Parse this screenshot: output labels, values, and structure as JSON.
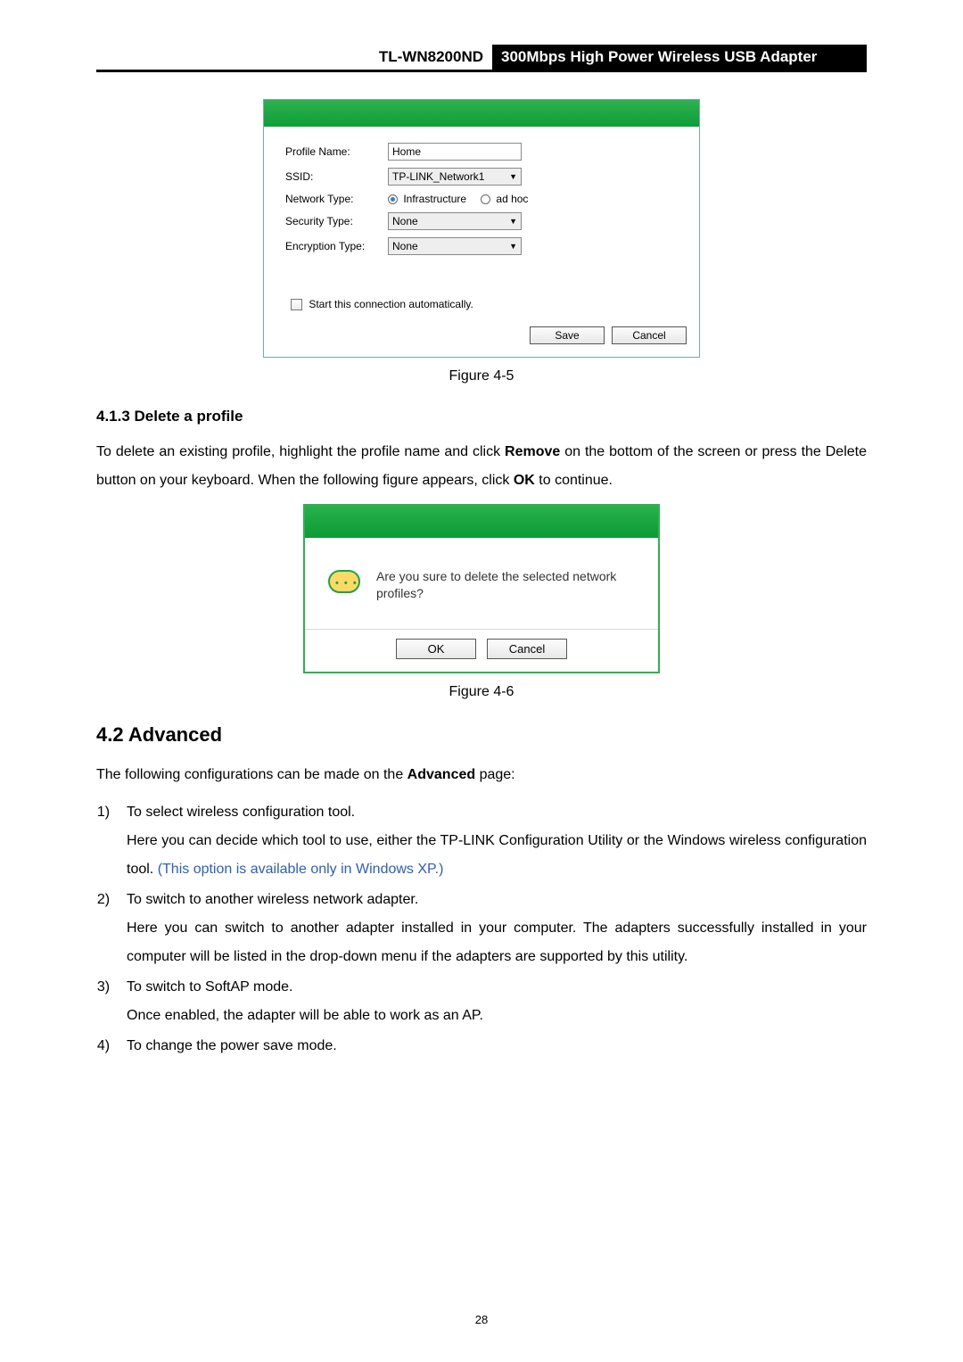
{
  "header": {
    "model": "TL-WN8200ND",
    "product": "300Mbps High Power Wireless USB Adapter"
  },
  "fig45": {
    "labels": {
      "profile_name": "Profile Name:",
      "ssid": "SSID:",
      "network_type": "Network Type:",
      "security_type": "Security Type:",
      "encryption_type": "Encryption Type:"
    },
    "values": {
      "profile_name": "Home",
      "ssid": "TP-LINK_Network1",
      "security_type": "None",
      "encryption_type": "None"
    },
    "radios": {
      "infrastructure": "Infrastructure",
      "adhoc": "ad hoc"
    },
    "start_auto": "Start this connection automatically.",
    "save_btn": "Save",
    "cancel_btn": "Cancel",
    "caption": "Figure 4-5"
  },
  "sec413": {
    "heading": "4.1.3  Delete a profile",
    "para_pre": "To delete an existing profile, highlight the profile name and click ",
    "remove": "Remove",
    "para_mid": " on the bottom of the screen or press the Delete button on your keyboard. When the following figure appears, click ",
    "ok": "OK",
    "para_post": " to continue."
  },
  "fig46": {
    "msg": "Are you sure to delete the selected network profiles?",
    "ok_btn": "OK",
    "cancel_btn": "Cancel",
    "caption": "Figure 4-6"
  },
  "sec42": {
    "heading": "4.2   Advanced",
    "intro_pre": "The following configurations can be made on the ",
    "intro_bold": "Advanced",
    "intro_post": " page:",
    "items": {
      "i1_a": "To select wireless configuration tool.",
      "i1_b_pre": "Here you can decide which tool to use, either the TP-LINK Configuration Utility or the Windows wireless configuration tool. ",
      "i1_b_note": "(This option is available only in Windows XP.)",
      "i2_a": "To switch to another wireless network adapter.",
      "i2_b": "Here you can switch to another adapter installed in your computer. The adapters successfully installed in your computer will be listed in the drop-down menu if the adapters are supported by this utility.",
      "i3_a": "To switch to SoftAP mode.",
      "i3_b": "Once enabled, the adapter will be able to work as an AP.",
      "i4_a": "To change the power save mode."
    }
  },
  "page_number": "28"
}
